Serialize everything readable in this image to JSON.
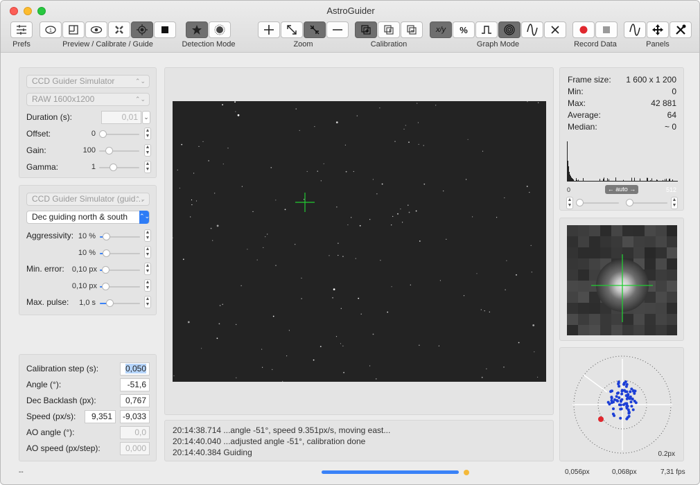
{
  "window": {
    "title": "AstroGuider"
  },
  "toolbar": {
    "groups": {
      "prefs": "Prefs",
      "mode": "Preview / Calibrate / Guide",
      "detection": "Detection Mode",
      "zoom": "Zoom",
      "calibration": "Calibration",
      "graph": "Graph Mode",
      "record": "Record Data",
      "panels": "Panels"
    },
    "graph_mode_xy_label": "x/y",
    "graph_mode_percent_label": "%"
  },
  "camera_panel": {
    "camera_select": "CCD Guider Simulator",
    "format_select": "RAW 1600x1200",
    "duration_label": "Duration (s):",
    "duration_value": "0,01",
    "offset_label": "Offset:",
    "offset_value": "0",
    "gain_label": "Gain:",
    "gain_value": "100",
    "gamma_label": "Gamma:",
    "gamma_value": "1"
  },
  "guider_panel": {
    "guider_select": "CCD Guider Simulator (guid…",
    "dec_select": "Dec guiding north & south",
    "aggressivity_label": "Aggressivity:",
    "aggressivity_ra": "10 %",
    "aggressivity_dec": "10 %",
    "min_error_label": "Min. error:",
    "min_error_ra": "0,10 px",
    "min_error_dec": "0,10 px",
    "max_pulse_label": "Max. pulse:",
    "max_pulse_value": "1,0 s"
  },
  "calibration_panel": {
    "step_label": "Calibration step (s):",
    "step_value": "0,050",
    "angle_label": "Angle (°):",
    "angle_value": "-51,6",
    "backlash_label": "Dec Backlash (px):",
    "backlash_value": "0,767",
    "speed_label": "Speed (px/s):",
    "speed_x": "9,351",
    "speed_y": "-9,033",
    "ao_angle_label": "AO angle (°):",
    "ao_angle_value": "0,0",
    "ao_speed_label": "AO speed (px/step):",
    "ao_speed_value": "0,000"
  },
  "log": [
    "20:14:38.714 ...angle -51°, speed 9.351px/s, moving east...",
    "20:14:40.040 ...adjusted angle -51°, calibration done",
    "20:14:40.384 Guiding"
  ],
  "stats": {
    "frame_size_label": "Frame size:",
    "frame_size_value": "1 600 x 1 200",
    "min_label": "Min:",
    "min_value": "0",
    "max_label": "Max:",
    "max_value": "42 881",
    "average_label": "Average:",
    "average_value": "64",
    "median_label": "Median:",
    "median_value": "~ 0",
    "histogram_low": "0",
    "histogram_high": "512",
    "histogram_mode": "← auto →"
  },
  "scatter": {
    "scale_label": "0.2px"
  },
  "status_bar": {
    "left_text": "--",
    "progress": 1.0,
    "rms_ra": "0,056px",
    "rms_dec": "0,068px",
    "fps": "7,31 fps"
  },
  "colors": {
    "accent": "#3a82f7",
    "crosshair": "#22cc33",
    "record": "#e0282e",
    "scatter_points": "#1d3fd6"
  }
}
